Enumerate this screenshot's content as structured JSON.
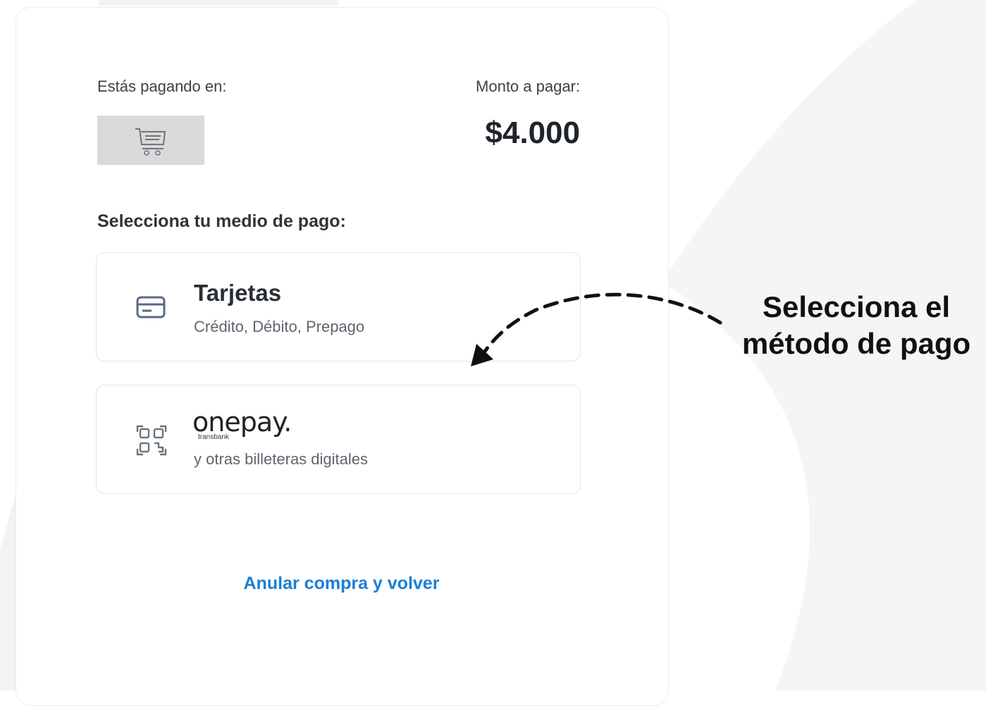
{
  "payment": {
    "paying_in_label": "Estás pagando en:",
    "amount_label": "Monto a pagar:",
    "amount_value": "$4.000",
    "merchant_logo_icon": "shopping-cart-icon"
  },
  "methods": {
    "title": "Selecciona tu medio de pago:",
    "options": [
      {
        "title": "Tarjetas",
        "subtitle": "Crédito, Débito, Prepago",
        "icon": "credit-card-icon"
      },
      {
        "brand": "onepay.",
        "brand_sub": "transbank",
        "subtitle": "y otras billeteras digitales",
        "icon": "qr-code-icon"
      }
    ]
  },
  "cancel_label": "Anular compra y volver",
  "callout": {
    "line1": "Selecciona el",
    "line2": "método de pago"
  },
  "colors": {
    "link": "#1a7fd6",
    "logo_bg": "#dadada",
    "background_shape": "#f4f5f7"
  }
}
